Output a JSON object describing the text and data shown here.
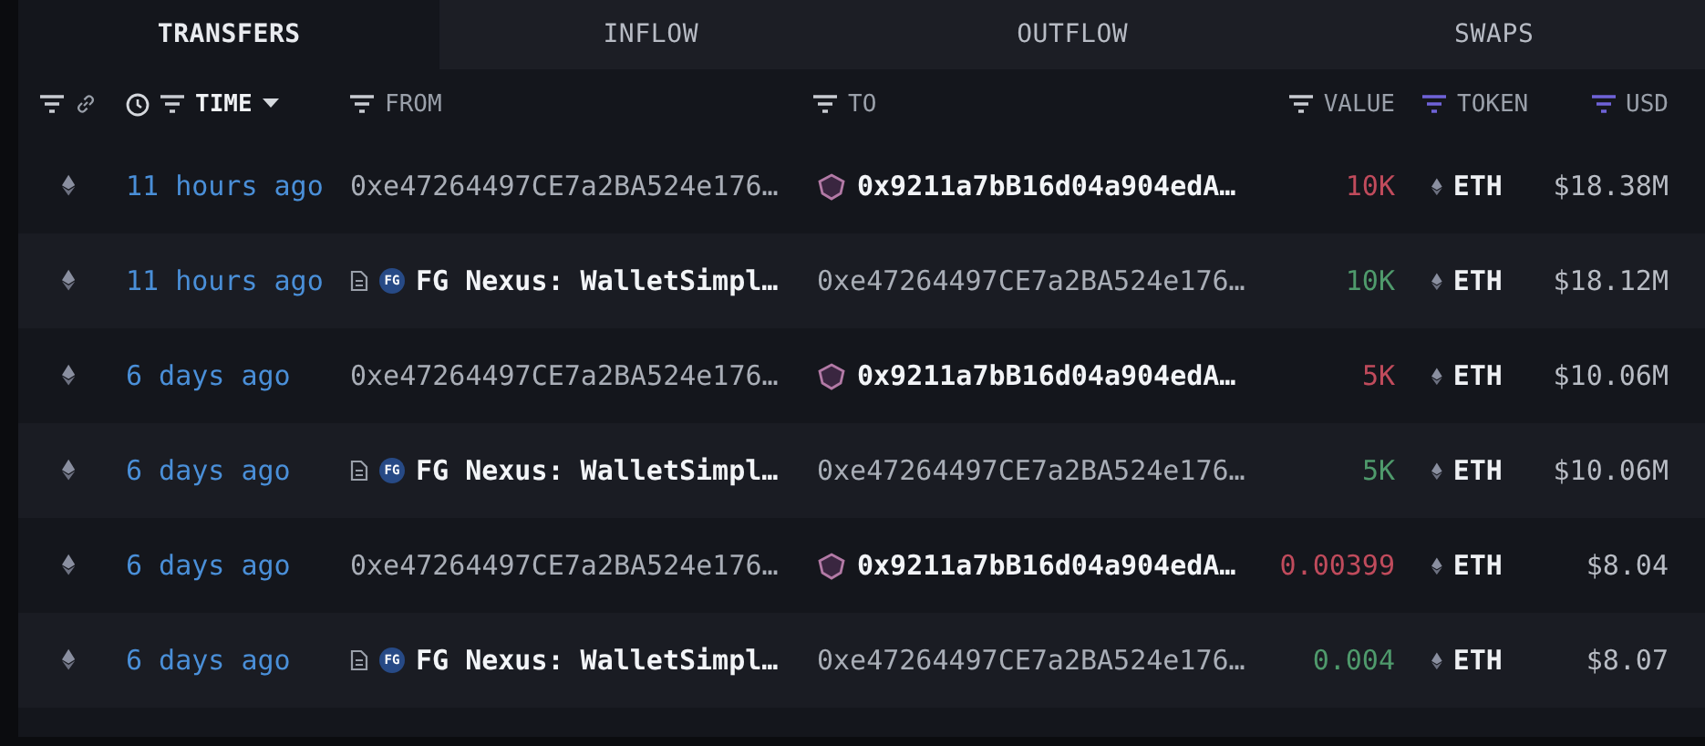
{
  "tabs": [
    {
      "label": "TRANSFERS",
      "selected": true
    },
    {
      "label": "INFLOW",
      "selected": false
    },
    {
      "label": "OUTFLOW",
      "selected": false
    },
    {
      "label": "SWAPS",
      "selected": false
    }
  ],
  "columns": [
    {
      "label": "TIME",
      "sorted": true,
      "filtered": false
    },
    {
      "label": "FROM",
      "sorted": false,
      "filtered": false
    },
    {
      "label": "TO",
      "sorted": false,
      "filtered": false
    },
    {
      "label": "VALUE",
      "sorted": false,
      "filtered": false
    },
    {
      "label": "TOKEN",
      "sorted": false,
      "filtered": true
    },
    {
      "label": "USD",
      "sorted": false,
      "filtered": true
    }
  ],
  "rows": [
    {
      "time": "11 hours ago",
      "from": {
        "kind": "address",
        "text": "0xe47264497CE7a2BA524e176…"
      },
      "to": {
        "kind": "wallet",
        "text": "0x9211a7bB16d04a904edA…"
      },
      "value": "10K",
      "color": "#c04b5c",
      "token": "ETH",
      "usd": "$18.38M"
    },
    {
      "time": "11 hours ago",
      "from": {
        "kind": "entity",
        "badge": "FG",
        "text": "FG Nexus: WalletSimpl…"
      },
      "to": {
        "kind": "address",
        "text": "0xe47264497CE7a2BA524e176…"
      },
      "value": "10K",
      "color": "#4f9a6c",
      "token": "ETH",
      "usd": "$18.12M"
    },
    {
      "time": "6 days ago",
      "from": {
        "kind": "address",
        "text": "0xe47264497CE7a2BA524e176…"
      },
      "to": {
        "kind": "wallet",
        "text": "0x9211a7bB16d04a904edA…"
      },
      "value": "5K",
      "color": "#c04b5c",
      "token": "ETH",
      "usd": "$10.06M"
    },
    {
      "time": "6 days ago",
      "from": {
        "kind": "entity",
        "badge": "FG",
        "text": "FG Nexus: WalletSimpl…"
      },
      "to": {
        "kind": "address",
        "text": "0xe47264497CE7a2BA524e176…"
      },
      "value": "5K",
      "color": "#4f9a6c",
      "token": "ETH",
      "usd": "$10.06M"
    },
    {
      "time": "6 days ago",
      "from": {
        "kind": "address",
        "text": "0xe47264497CE7a2BA524e176…"
      },
      "to": {
        "kind": "wallet",
        "text": "0x9211a7bB16d04a904edA…"
      },
      "value": "0.00399",
      "color": "#c04b5c",
      "token": "ETH",
      "usd": "$8.04"
    },
    {
      "time": "6 days ago",
      "from": {
        "kind": "entity",
        "badge": "FG",
        "text": "FG Nexus: WalletSimpl…"
      },
      "to": {
        "kind": "address",
        "text": "0xe47264497CE7a2BA524e176…"
      },
      "value": "0.004",
      "color": "#4f9a6c",
      "token": "ETH",
      "usd": "$8.07"
    }
  ]
}
